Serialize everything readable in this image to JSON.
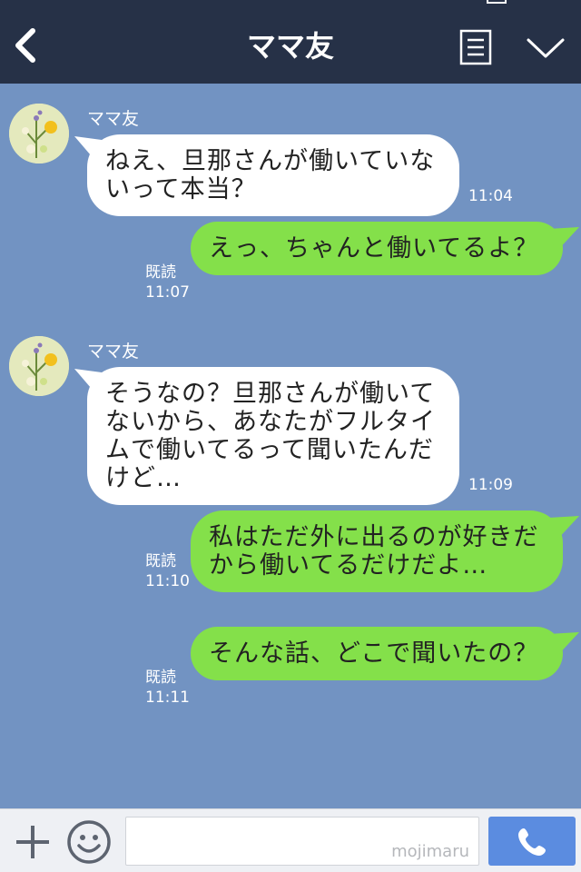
{
  "header": {
    "title": "ママ友",
    "back_icon": "chevron-left-icon",
    "menu_icon": "menu-list-icon",
    "collapse_icon": "chevron-down-icon"
  },
  "colors": {
    "header_bg": "#263147",
    "chat_bg": "#7293c2",
    "incoming_bubble": "#ffffff",
    "outgoing_bubble": "#84e04a",
    "send_button": "#5b8ce0"
  },
  "messages": [
    {
      "sender": "ママ友",
      "text": "ねえ、旦那さんが働いていないって本当？",
      "time": "11:04"
    },
    {
      "text": "えっ、ちゃんと働いてるよ？",
      "read": "既読",
      "time": "11:07"
    },
    {
      "sender": "ママ友",
      "text": "そうなの？旦那さんが働いてないから、あなたがフルタイムで働いてるって聞いたんだけど…",
      "time": "11:09"
    },
    {
      "text": "私はただ外に出るのが好きだから働いてるだけだよ…",
      "read": "既読",
      "time": "11:10"
    },
    {
      "text": "そんな話、どこで聞いたの？",
      "read": "既読",
      "time": "11:11"
    }
  ],
  "bottombar": {
    "plus_icon": "plus-icon",
    "emoji_icon": "smiley-icon",
    "input_value": "",
    "watermark": "mojimaru",
    "call_icon": "phone-icon"
  }
}
